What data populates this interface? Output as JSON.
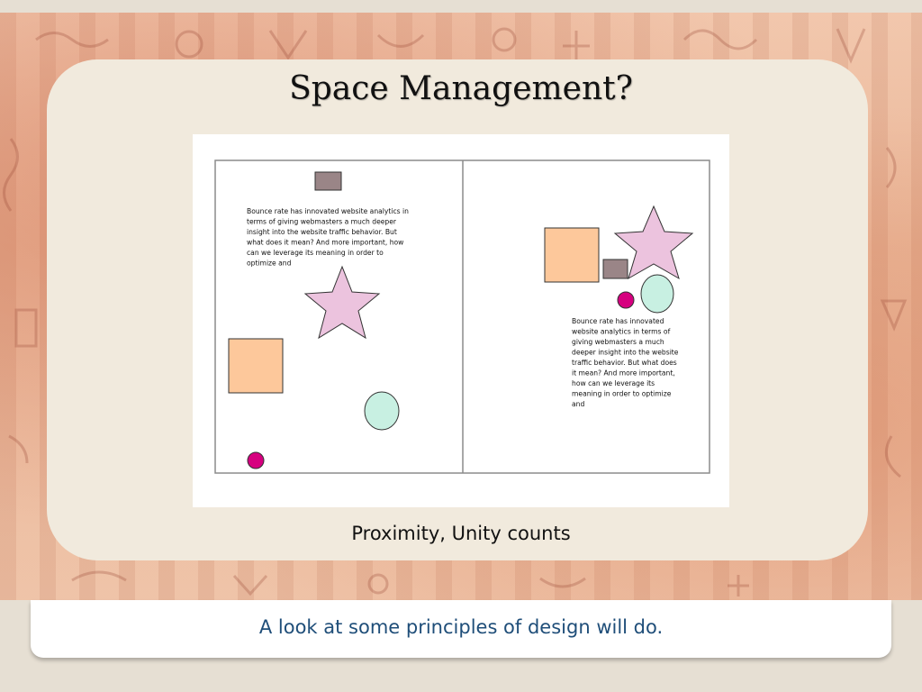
{
  "slide": {
    "title": "Space Management?",
    "caption": "Proximity, Unity counts",
    "footer": "A look at some principles of design will do."
  },
  "figure": {
    "left_text_lines": [
      "Bounce rate has innovated website analytics in",
      "terms of giving webmasters a much deeper",
      "insight into the website traffic behavior. But",
      "what does it mean? And more important, how",
      "can we leverage its meaning in order to",
      "optimize and"
    ],
    "right_text_lines": [
      "Bounce rate has innovated",
      "website analytics in terms of",
      "giving webmasters a much",
      "deeper insight into the website",
      "traffic behavior. But what does",
      "it mean? And more important,",
      "how can we leverage its",
      "meaning in order to optimize",
      "and"
    ],
    "colors": {
      "square": "#fdc89b",
      "rectangle": "#9a8587",
      "star": "#ecc3de",
      "circle": "#c8f0e2",
      "dot": "#d6007f",
      "frame": "#8c8c8c"
    }
  }
}
